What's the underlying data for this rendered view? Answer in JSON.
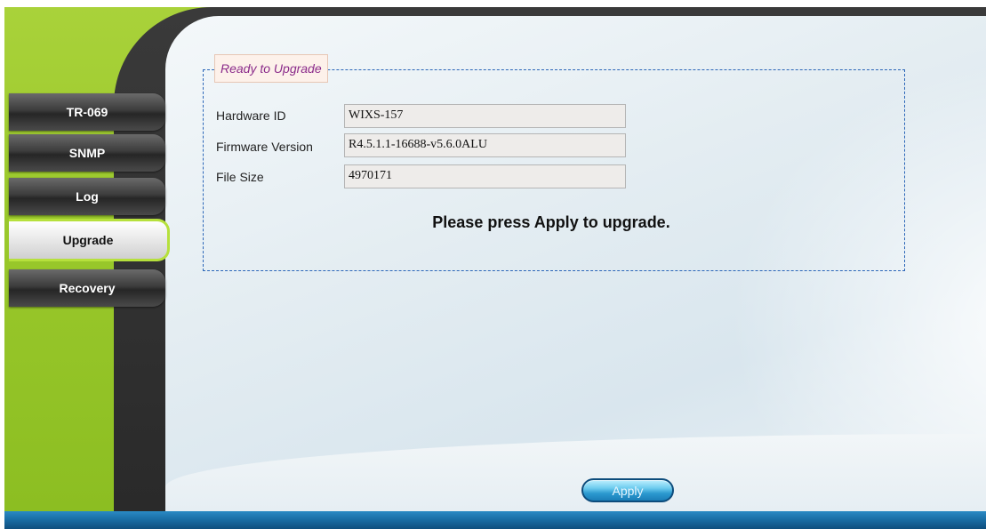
{
  "sidebar": {
    "items": [
      {
        "label": "TR-069",
        "active": false
      },
      {
        "label": "SNMP",
        "active": false
      },
      {
        "label": "Log",
        "active": false
      },
      {
        "label": "Upgrade",
        "active": true
      },
      {
        "label": "Recovery",
        "active": false
      }
    ]
  },
  "upgrade": {
    "legend": "Ready to Upgrade",
    "rows": [
      {
        "label": "Hardware ID",
        "value": "WIXS-157"
      },
      {
        "label": "Firmware Version",
        "value": "R4.5.1.1-16688-v5.6.0ALU"
      },
      {
        "label": "File Size",
        "value": "4970171"
      }
    ],
    "notice": "Please press Apply to upgrade."
  },
  "footer": {
    "apply_label": "Apply"
  },
  "colors": {
    "accent_lime": "#9bc92c",
    "frame_dark": "#2a2a2a",
    "legend_text": "#8a2a8a",
    "fieldset_border": "#2b66b8",
    "footer_blue": "#1a6ea6"
  }
}
